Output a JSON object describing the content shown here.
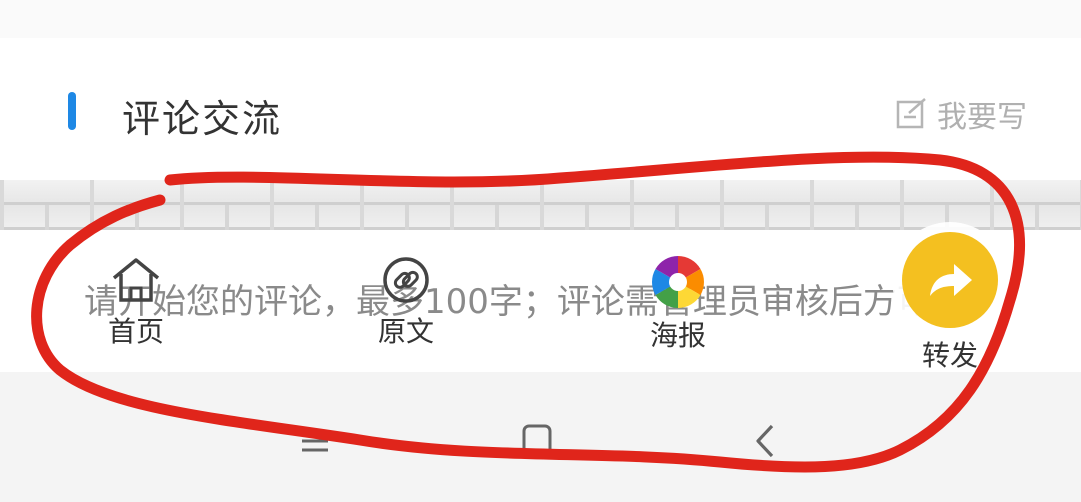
{
  "header": {
    "title": "评论交流",
    "write_label": "我要写"
  },
  "comment": {
    "placeholder": "请开始您的评论，最多100字；评论需管理员审核后方可见"
  },
  "action_bar": {
    "items": [
      {
        "label": "首页",
        "icon": "home-icon"
      },
      {
        "label": "原文",
        "icon": "link-icon"
      },
      {
        "label": "海报",
        "icon": "camera-aperture-icon"
      },
      {
        "label": "转发",
        "icon": "share-arrow-icon"
      }
    ]
  },
  "system_nav": {
    "icons": [
      "menu-icon",
      "home-square-icon",
      "back-icon"
    ]
  },
  "colors": {
    "accent": "#1e88e5",
    "share": "#f4c020",
    "annotation": "#e0251b"
  }
}
